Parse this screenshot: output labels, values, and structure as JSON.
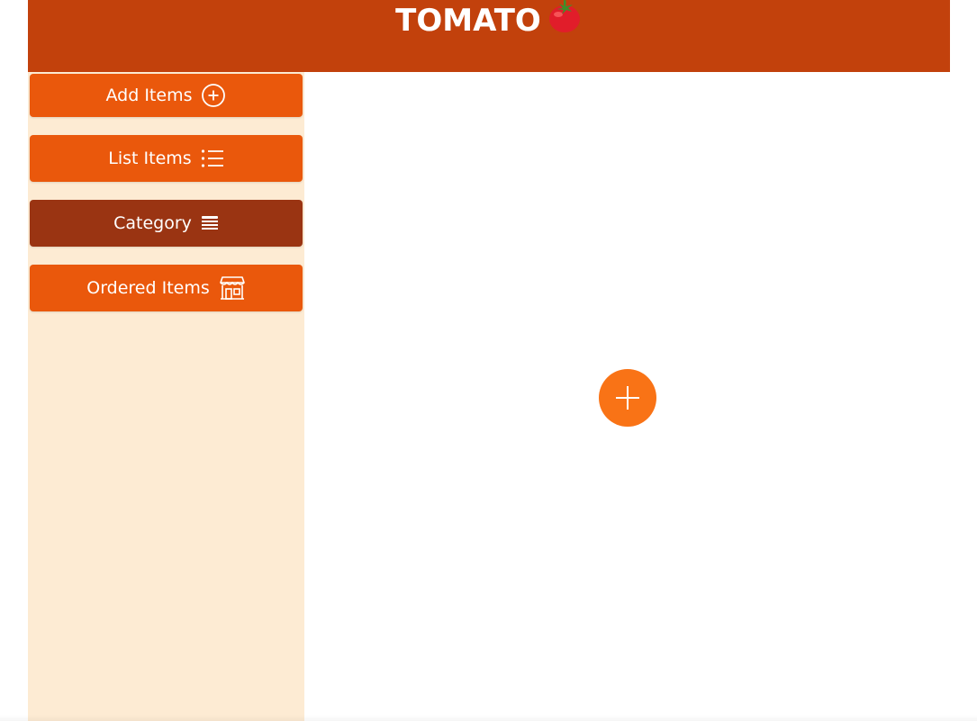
{
  "header": {
    "title": "TOMATO",
    "logo_icon": "tomato-icon",
    "background": "#c2410c"
  },
  "sidebar": {
    "background": "#fdebd3",
    "items": [
      {
        "label": "Add Items",
        "icon": "add-circle-icon",
        "active": false
      },
      {
        "label": "List Items",
        "icon": "list-icon",
        "active": false
      },
      {
        "label": "Category",
        "icon": "stack-icon",
        "active": true
      },
      {
        "label": "Ordered Items",
        "icon": "store-icon",
        "active": false
      }
    ]
  },
  "main": {
    "fab": {
      "icon": "plus-icon",
      "color": "#f97316"
    }
  },
  "colors": {
    "accent": "#ea580c",
    "active": "#9a3412"
  }
}
